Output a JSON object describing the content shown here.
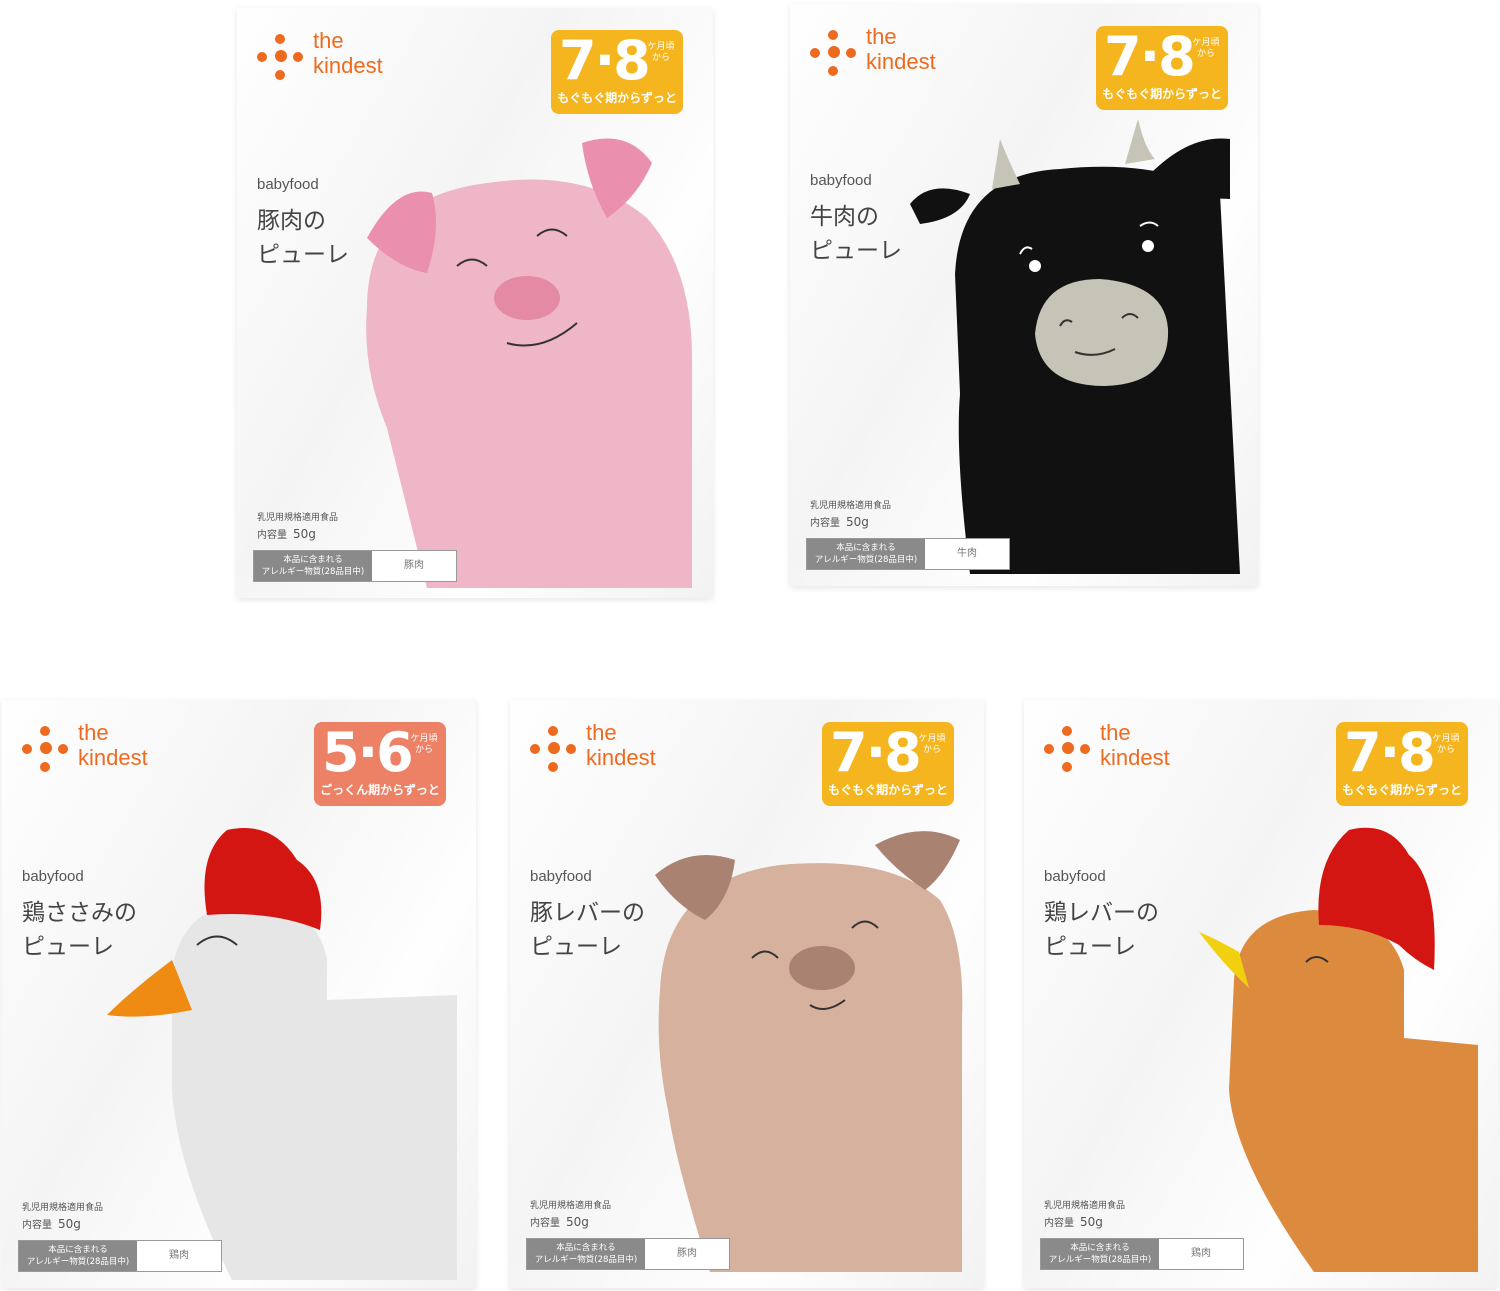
{
  "brand": {
    "line1": "the",
    "line2": "kindest"
  },
  "packages": [
    {
      "age": "7·8",
      "age_unit": "ケ月頃から",
      "age_phrase": "もぐもぐ期からずっと",
      "category": "babyfood",
      "name_line1": "豚肉の",
      "name_line2": "ピューレ",
      "standard": "乳児用規格適用食品",
      "content_label": "内容量",
      "content_value": "50g",
      "allergy_label_1": "本品に含まれる",
      "allergy_label_2": "アレルギー物質(28品目中)",
      "allergy_value": "豚肉",
      "animal": "pig-illustration",
      "color": "#efb6c8"
    },
    {
      "age": "7·8",
      "age_unit": "ケ月頃から",
      "age_phrase": "もぐもぐ期からずっと",
      "category": "babyfood",
      "name_line1": "牛肉の",
      "name_line2": "ピューレ",
      "standard": "乳児用規格適用食品",
      "content_label": "内容量",
      "content_value": "50g",
      "allergy_label_1": "本品に含まれる",
      "allergy_label_2": "アレルギー物質(28品目中)",
      "allergy_value": "牛肉",
      "animal": "cow-illustration",
      "color": "#111111"
    },
    {
      "age": "5·6",
      "age_unit": "ケ月頃から",
      "age_phrase": "ごっくん期からずっと",
      "category": "babyfood",
      "name_line1": "鶏ささみの",
      "name_line2": "ピューレ",
      "standard": "乳児用規格適用食品",
      "content_label": "内容量",
      "content_value": "50g",
      "allergy_label_1": "本品に含まれる",
      "allergy_label_2": "アレルギー物質(28品目中)",
      "allergy_value": "鶏肉",
      "animal": "white-chicken-illustration",
      "color": "#e6e6e6"
    },
    {
      "age": "7·8",
      "age_unit": "ケ月頃から",
      "age_phrase": "もぐもぐ期からずっと",
      "category": "babyfood",
      "name_line1": "豚レバーの",
      "name_line2": "ピューレ",
      "standard": "乳児用規格適用食品",
      "content_label": "内容量",
      "content_value": "50g",
      "allergy_label_1": "本品に含まれる",
      "allergy_label_2": "アレルギー物質(28品目中)",
      "allergy_value": "豚肉",
      "animal": "tan-pig-illustration",
      "color": "#d6b29e"
    },
    {
      "age": "7·8",
      "age_unit": "ケ月頃から",
      "age_phrase": "もぐもぐ期からずっと",
      "category": "babyfood",
      "name_line1": "鶏レバーの",
      "name_line2": "ピューレ",
      "standard": "乳児用規格適用食品",
      "content_label": "内容量",
      "content_value": "50g",
      "allergy_label_1": "本品に含まれる",
      "allergy_label_2": "アレルギー物質(28品目中)",
      "allergy_value": "鶏肉",
      "animal": "brown-chicken-illustration",
      "color": "#dc8a3e"
    }
  ]
}
